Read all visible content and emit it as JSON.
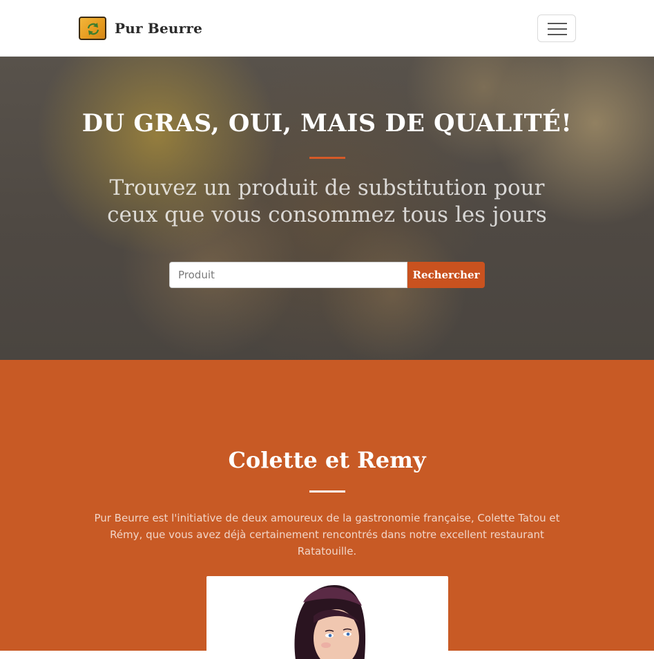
{
  "navbar": {
    "brand_name": "Pur Beurre",
    "logo_icon": "refresh-arrows-icon",
    "menu_icon": "hamburger-menu-icon"
  },
  "hero": {
    "title": "DU GRAS, OUI, MAIS DE QUALITÉ!",
    "subtitle": "Trouvez un produit de substitution pour ceux que vous consommez tous les jours",
    "search": {
      "placeholder": "Produit",
      "value": "",
      "button_label": "Rechercher"
    }
  },
  "about": {
    "title": "Colette et Remy",
    "text": "Pur Beurre est l'initiative de deux amoureux de la gastronomie française, Colette Tatou et Rémy, que vous avez déjà certainement rencontrés dans notre excellent restaurant Ratatouille."
  },
  "colors": {
    "accent": "#c85a25",
    "hero_overlay": "#4f4943",
    "logo": "#f2b63a"
  }
}
